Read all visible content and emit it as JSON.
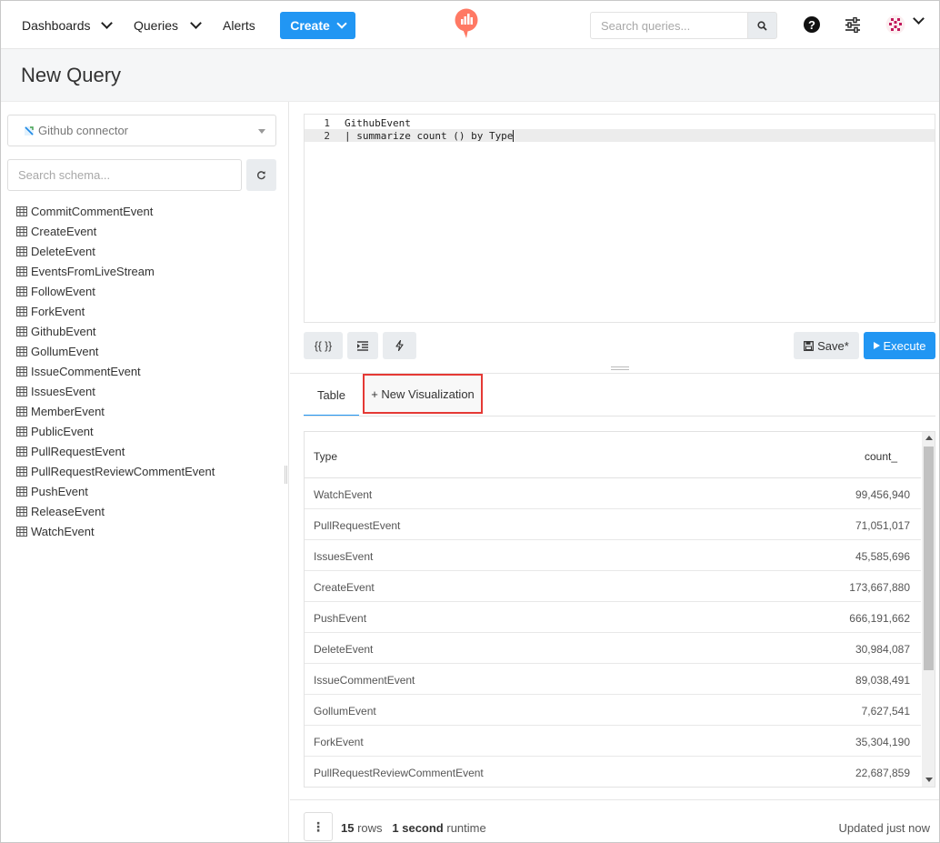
{
  "nav": {
    "dashboards": "Dashboards",
    "queries": "Queries",
    "alerts": "Alerts",
    "create": "Create",
    "search_placeholder": "Search queries..."
  },
  "page": {
    "title": "New Query"
  },
  "sidebar": {
    "data_source": "Github connector",
    "schema_placeholder": "Search schema...",
    "tables": [
      "CommitCommentEvent",
      "CreateEvent",
      "DeleteEvent",
      "EventsFromLiveStream",
      "FollowEvent",
      "ForkEvent",
      "GithubEvent",
      "GollumEvent",
      "IssueCommentEvent",
      "IssuesEvent",
      "MemberEvent",
      "PublicEvent",
      "PullRequestEvent",
      "PullRequestReviewCommentEvent",
      "PushEvent",
      "ReleaseEvent",
      "WatchEvent"
    ]
  },
  "editor": {
    "lines": [
      {
        "num": "1",
        "text": "GithubEvent"
      },
      {
        "num": "2",
        "text": "| summarize count () by Type"
      }
    ],
    "params_label": "{{ }}",
    "save_label": "Save*",
    "execute_label": "Execute"
  },
  "tabs": {
    "table": "Table",
    "new_viz": "+ New Visualization"
  },
  "results": {
    "columns": {
      "type": "Type",
      "count": "count_"
    },
    "rows": [
      {
        "type": "WatchEvent",
        "count": "99,456,940"
      },
      {
        "type": "PullRequestEvent",
        "count": "71,051,017"
      },
      {
        "type": "IssuesEvent",
        "count": "45,585,696"
      },
      {
        "type": "CreateEvent",
        "count": "173,667,880"
      },
      {
        "type": "PushEvent",
        "count": "666,191,662"
      },
      {
        "type": "DeleteEvent",
        "count": "30,984,087"
      },
      {
        "type": "IssueCommentEvent",
        "count": "89,038,491"
      },
      {
        "type": "GollumEvent",
        "count": "7,627,541"
      },
      {
        "type": "ForkEvent",
        "count": "35,304,190"
      },
      {
        "type": "PullRequestReviewCommentEvent",
        "count": "22,687,859"
      }
    ]
  },
  "footer": {
    "rows_count": "15",
    "rows_label": "rows",
    "runtime_value": "1 second",
    "runtime_label": "runtime",
    "updated": "Updated just now"
  },
  "colors": {
    "primary": "#2196f3",
    "logo": "#ff7964",
    "highlight_border": "#e53935"
  },
  "icons": {
    "search": "search-icon",
    "help": "question-circle-icon",
    "settings": "sliders-icon",
    "refresh": "refresh-icon",
    "table": "table-icon",
    "save": "floppy-disk-icon",
    "execute": "play-icon"
  }
}
